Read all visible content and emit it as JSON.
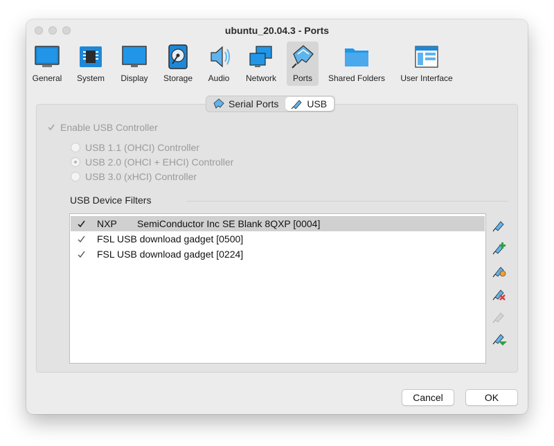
{
  "window": {
    "title": "ubuntu_20.04.3 - Ports"
  },
  "toolbar": {
    "items": [
      {
        "label": "General",
        "icon": "general-icon"
      },
      {
        "label": "System",
        "icon": "chip-icon"
      },
      {
        "label": "Display",
        "icon": "monitor-icon"
      },
      {
        "label": "Storage",
        "icon": "disk-icon"
      },
      {
        "label": "Audio",
        "icon": "speaker-icon"
      },
      {
        "label": "Network",
        "icon": "network-icon"
      },
      {
        "label": "Ports",
        "icon": "ports-icon"
      },
      {
        "label": "Shared Folders",
        "icon": "folder-icon"
      },
      {
        "label": "User Interface",
        "icon": "ui-icon"
      }
    ],
    "selected": "Ports"
  },
  "tabs": {
    "serial": "Serial Ports",
    "usb": "USB",
    "active": "USB"
  },
  "usb": {
    "enable_label": "Enable USB Controller",
    "enable_checked": true,
    "controllers": [
      {
        "label": "USB 1.1 (OHCI) Controller",
        "selected": false
      },
      {
        "label": "USB 2.0 (OHCI + EHCI) Controller",
        "selected": true
      },
      {
        "label": "USB 3.0 (xHCI) Controller",
        "selected": false
      }
    ],
    "filters_title": "USB Device Filters",
    "filters": [
      {
        "vendor": "NXP",
        "name": "SemiConductor Inc SE Blank 8QXP [0004]",
        "checked": true,
        "selected": true
      },
      {
        "vendor": "",
        "name": "FSL USB download gadget [0500]",
        "checked": true,
        "selected": false
      },
      {
        "vendor": "",
        "name": "FSL USB download gadget [0224]",
        "checked": true,
        "selected": false
      }
    ]
  },
  "side_buttons": [
    {
      "icon": "usb-filter-edit-icon"
    },
    {
      "icon": "usb-filter-add-icon"
    },
    {
      "icon": "usb-filter-add-from-device-icon"
    },
    {
      "icon": "usb-filter-remove-icon"
    },
    {
      "icon": "usb-filter-move-up-icon"
    },
    {
      "icon": "usb-filter-move-down-icon"
    }
  ],
  "buttons": {
    "cancel": "Cancel",
    "ok": "OK"
  },
  "colors": {
    "accent": "#1a8ad4",
    "add": "#2ea043",
    "remove": "#d83b3b"
  }
}
